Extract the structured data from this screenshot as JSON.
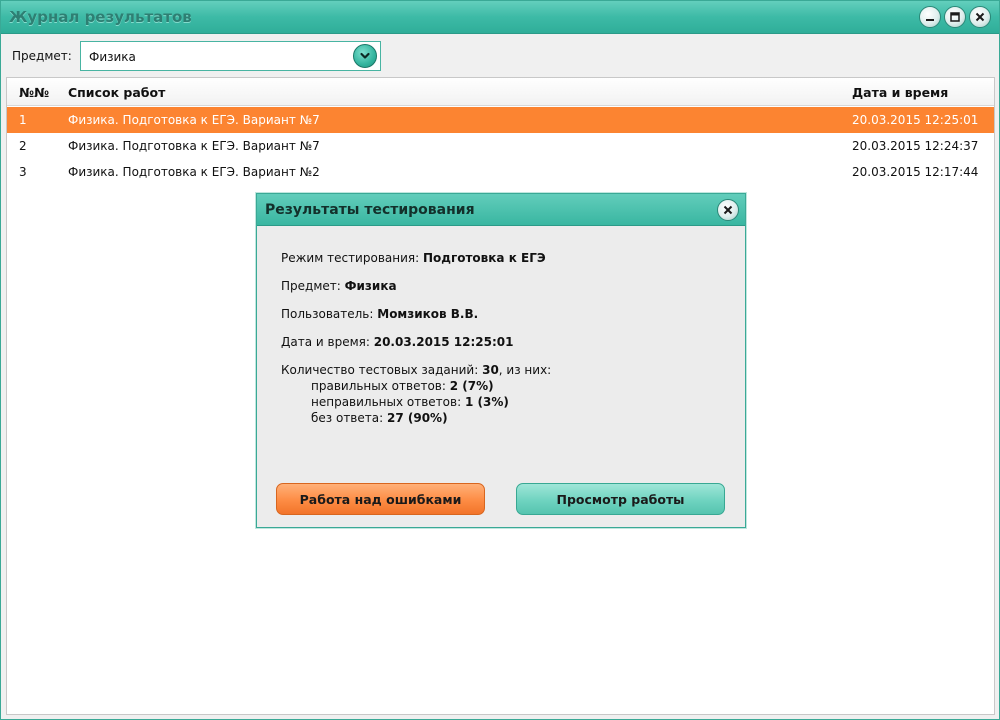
{
  "window": {
    "title": "Журнал результатов"
  },
  "toolbar": {
    "subject_label": "Предмет:",
    "subject_value": "Физика"
  },
  "table": {
    "columns": {
      "num": "№№",
      "title": "Список работ",
      "datetime": "Дата и время"
    },
    "rows": [
      {
        "num": "1",
        "title": "Физика. Подготовка к ЕГЭ. Вариант №7",
        "datetime": "20.03.2015 12:25:01",
        "selected": true
      },
      {
        "num": "2",
        "title": "Физика. Подготовка к ЕГЭ. Вариант №7",
        "datetime": "20.03.2015 12:24:37",
        "selected": false
      },
      {
        "num": "3",
        "title": "Физика. Подготовка к ЕГЭ. Вариант №2",
        "datetime": "20.03.2015 12:17:44",
        "selected": false
      }
    ]
  },
  "dialog": {
    "title": "Результаты тестирования",
    "mode_label": "Режим тестирования:",
    "mode_value": "Подготовка к ЕГЭ",
    "subject_label": "Предмет:",
    "subject_value": "Физика",
    "user_label": "Пользователь:",
    "user_value": "Момзиков В.В.",
    "datetime_label": "Дата и время:",
    "datetime_value": "20.03.2015 12:25:01",
    "count_label": "Количество тестовых заданий:",
    "count_value": "30",
    "count_suffix": ", из них:",
    "correct_label": "правильных ответов:",
    "correct_value": "2 (7%)",
    "wrong_label": "неправильных ответов:",
    "wrong_value": "1 (3%)",
    "none_label": "без ответа:",
    "none_value": "27 (90%)",
    "errors_button": "Работа над ошибками",
    "review_button": "Просмотр работы"
  },
  "colors": {
    "accent": "#3dbaa6",
    "selection": "#fc8431"
  }
}
